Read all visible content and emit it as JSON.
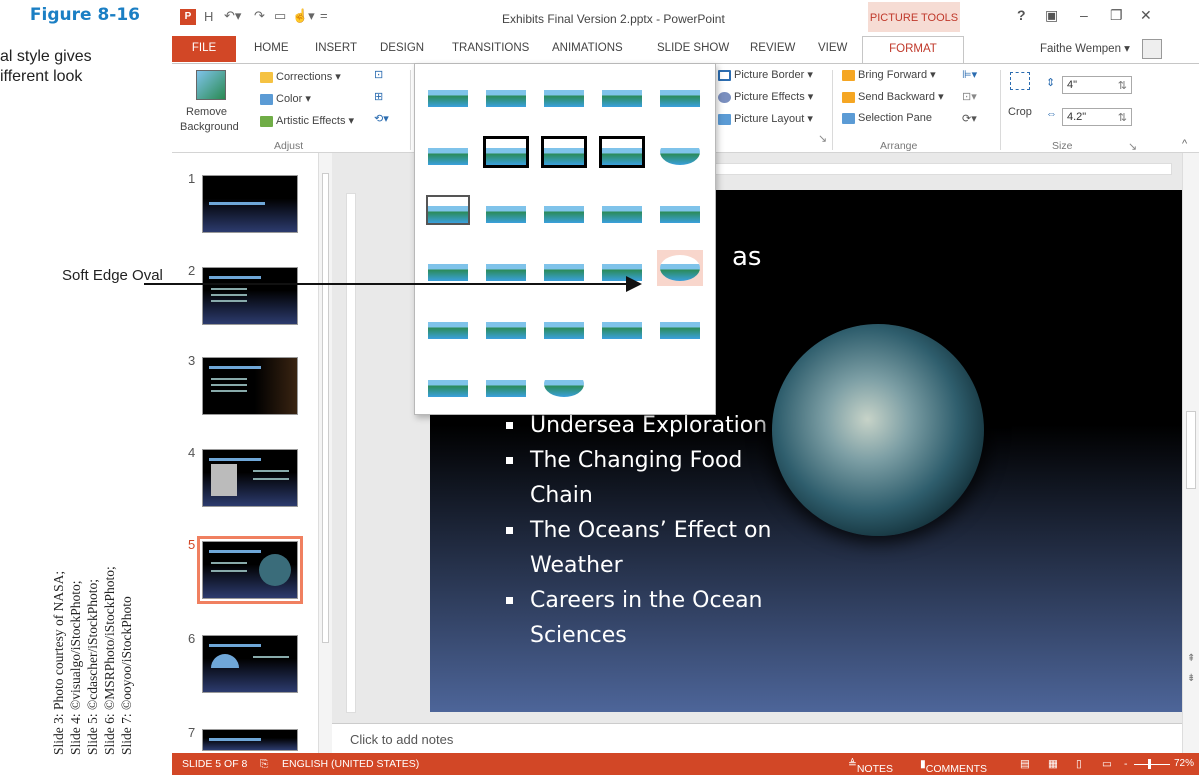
{
  "figure": {
    "title": "Figure 8-16",
    "caption_line1": "al style gives",
    "caption_line2": "ifferent look",
    "callout": "Soft Edge Oval",
    "credits": [
      "Slide 3: Photo courtesy of NASA;",
      "Slide 4: ©visualgo/iStockPhoto;",
      "Slide 5: ©cdascher/iStockPhoto;",
      "Slide 6: ©MSRPhoto/iStockPhoto;",
      "Slide 7: ©ooyoo/iStockPhoto"
    ]
  },
  "window": {
    "title": "Exhibits Final Version 2.pptx - PowerPoint",
    "context_tab": "PICTURE TOOLS",
    "user": "Faithe Wempen",
    "help": "?"
  },
  "tabs": [
    "FILE",
    "HOME",
    "INSERT",
    "DESIGN",
    "TRANSITIONS",
    "ANIMATIONS",
    "SLIDE SHOW",
    "REVIEW",
    "VIEW",
    "FORMAT"
  ],
  "ribbon": {
    "remove_bg_1": "Remove",
    "remove_bg_2": "Background",
    "corrections": "Corrections ▾",
    "color": "Color ▾",
    "artistic": "Artistic Effects ▾",
    "adjust": "Adjust",
    "picture_border": "Picture Border ▾",
    "picture_effects": "Picture Effects ▾",
    "picture_layout": "Picture Layout ▾",
    "bring_forward": "Bring Forward ▾",
    "send_backward": "Send Backward ▾",
    "selection_pane": "Selection Pane",
    "arrange": "Arrange",
    "crop": "Crop",
    "height": "4\"",
    "width": "4.2\"",
    "size": "Size"
  },
  "slides": [
    {
      "num": "1"
    },
    {
      "num": "2"
    },
    {
      "num": "3"
    },
    {
      "num": "4"
    },
    {
      "num": "5"
    },
    {
      "num": "6"
    },
    {
      "num": "7"
    }
  ],
  "slide": {
    "title_fragment": "as",
    "bullets": [
      "Undersea Exploration",
      "The Changing Food",
      "Chain",
      "The Oceans’ Effect on",
      "Weather",
      "Careers in the Ocean",
      "Sciences"
    ]
  },
  "notes_placeholder": "Click to add notes",
  "status": {
    "slide": "SLIDE 5 OF 8",
    "language": "ENGLISH (UNITED STATES)",
    "notes": "NOTES",
    "comments": "COMMENTS",
    "zoom": "72%"
  },
  "colors": {
    "accent": "#d24726",
    "context": "#c0392b",
    "highlight": "#f8d6cc"
  }
}
